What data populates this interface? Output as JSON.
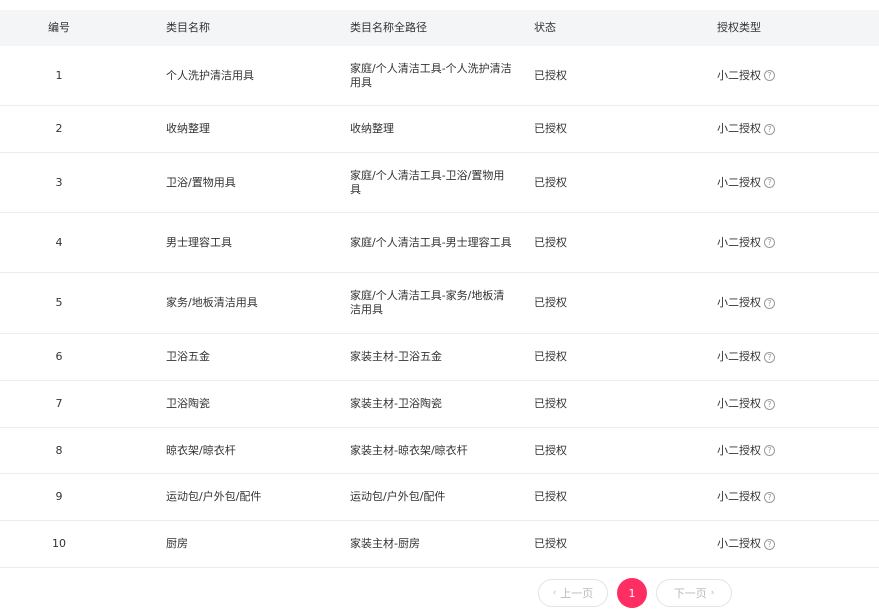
{
  "table": {
    "headers": {
      "idx": "编号",
      "name": "类目名称",
      "path": "类目名称全路径",
      "status": "状态",
      "auth": "授权类型"
    },
    "rows": [
      {
        "idx": "1",
        "name": "个人洗护清洁用具",
        "path": "家庭/个人清洁工具-个人洗护清洁用具",
        "status": "已授权",
        "auth": "小二授权"
      },
      {
        "idx": "2",
        "name": "收纳整理",
        "path": "收纳整理",
        "status": "已授权",
        "auth": "小二授权"
      },
      {
        "idx": "3",
        "name": "卫浴/置物用具",
        "path": "家庭/个人清洁工具-卫浴/置物用具",
        "status": "已授权",
        "auth": "小二授权"
      },
      {
        "idx": "4",
        "name": "男士理容工具",
        "path": "家庭/个人清洁工具-男士理容工具",
        "status": "已授权",
        "auth": "小二授权"
      },
      {
        "idx": "5",
        "name": "家务/地板清洁用具",
        "path": "家庭/个人清洁工具-家务/地板清洁用具",
        "status": "已授权",
        "auth": "小二授权"
      },
      {
        "idx": "6",
        "name": "卫浴五金",
        "path": "家装主材-卫浴五金",
        "status": "已授权",
        "auth": "小二授权"
      },
      {
        "idx": "7",
        "name": "卫浴陶瓷",
        "path": "家装主材-卫浴陶瓷",
        "status": "已授权",
        "auth": "小二授权"
      },
      {
        "idx": "8",
        "name": "晾衣架/晾衣杆",
        "path": "家装主材-晾衣架/晾衣杆",
        "status": "已授权",
        "auth": "小二授权"
      },
      {
        "idx": "9",
        "name": "运动包/户外包/配件",
        "path": "运动包/户外包/配件",
        "status": "已授权",
        "auth": "小二授权"
      },
      {
        "idx": "10",
        "name": "厨房",
        "path": "家装主材-厨房",
        "status": "已授权",
        "auth": "小二授权"
      }
    ]
  },
  "pagination": {
    "prev_label": "上一页",
    "current_page": "1",
    "next_label": "下一页"
  },
  "icons": {
    "help": "question-circle",
    "prev": "chevron-left",
    "next": "chevron-right"
  },
  "colors": {
    "accent": "#ff2e62",
    "header_bg": "#f4f5f7"
  }
}
